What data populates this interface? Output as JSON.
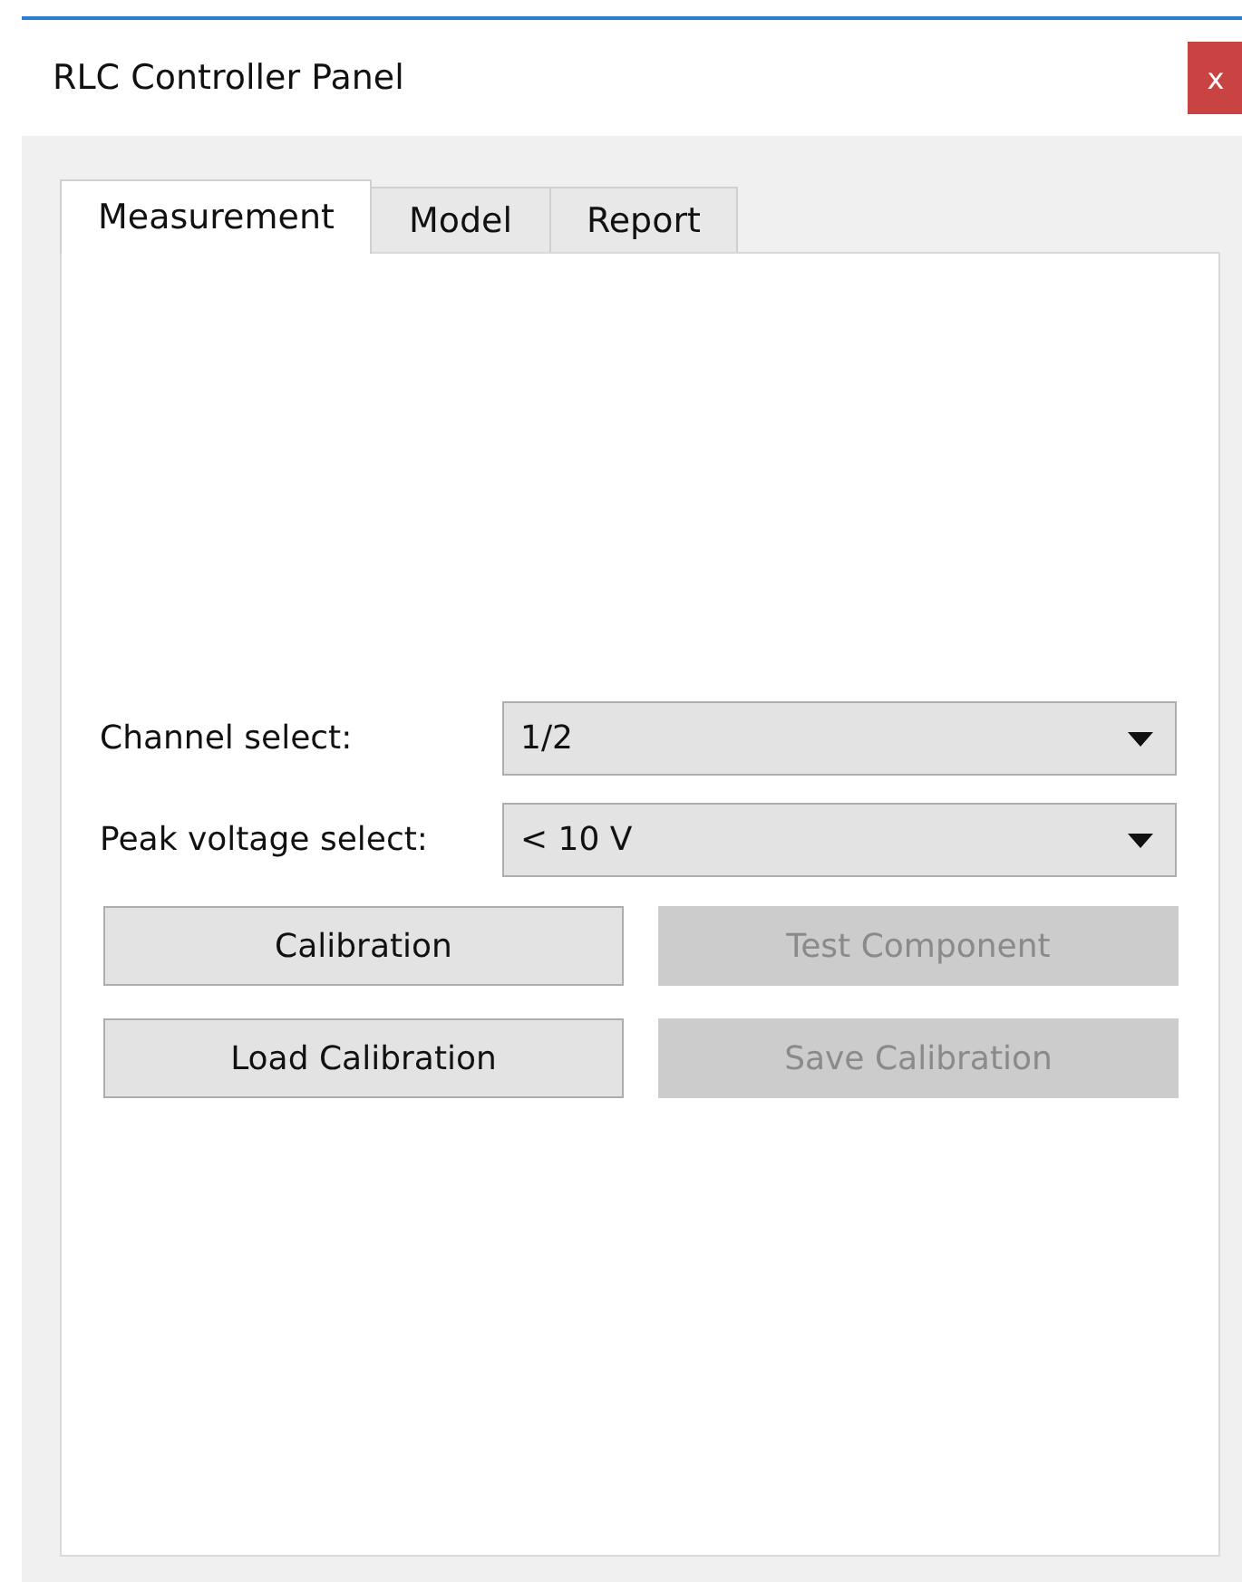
{
  "window": {
    "title": "RLC Controller Panel",
    "close": "x"
  },
  "tabs": [
    {
      "label": "Measurement",
      "selected": true
    },
    {
      "label": "Model",
      "selected": false
    },
    {
      "label": "Report",
      "selected": false
    }
  ],
  "fields": [
    {
      "label": "Channel select:",
      "value": "1/2"
    },
    {
      "label": "Peak voltage select:",
      "value": "< 10 V"
    }
  ],
  "buttons": [
    {
      "label": "Calibration",
      "disabled": false
    },
    {
      "label": "Test Component",
      "disabled": true
    },
    {
      "label": "Load Calibration",
      "disabled": false
    },
    {
      "label": "Save Calibration",
      "disabled": true
    }
  ]
}
